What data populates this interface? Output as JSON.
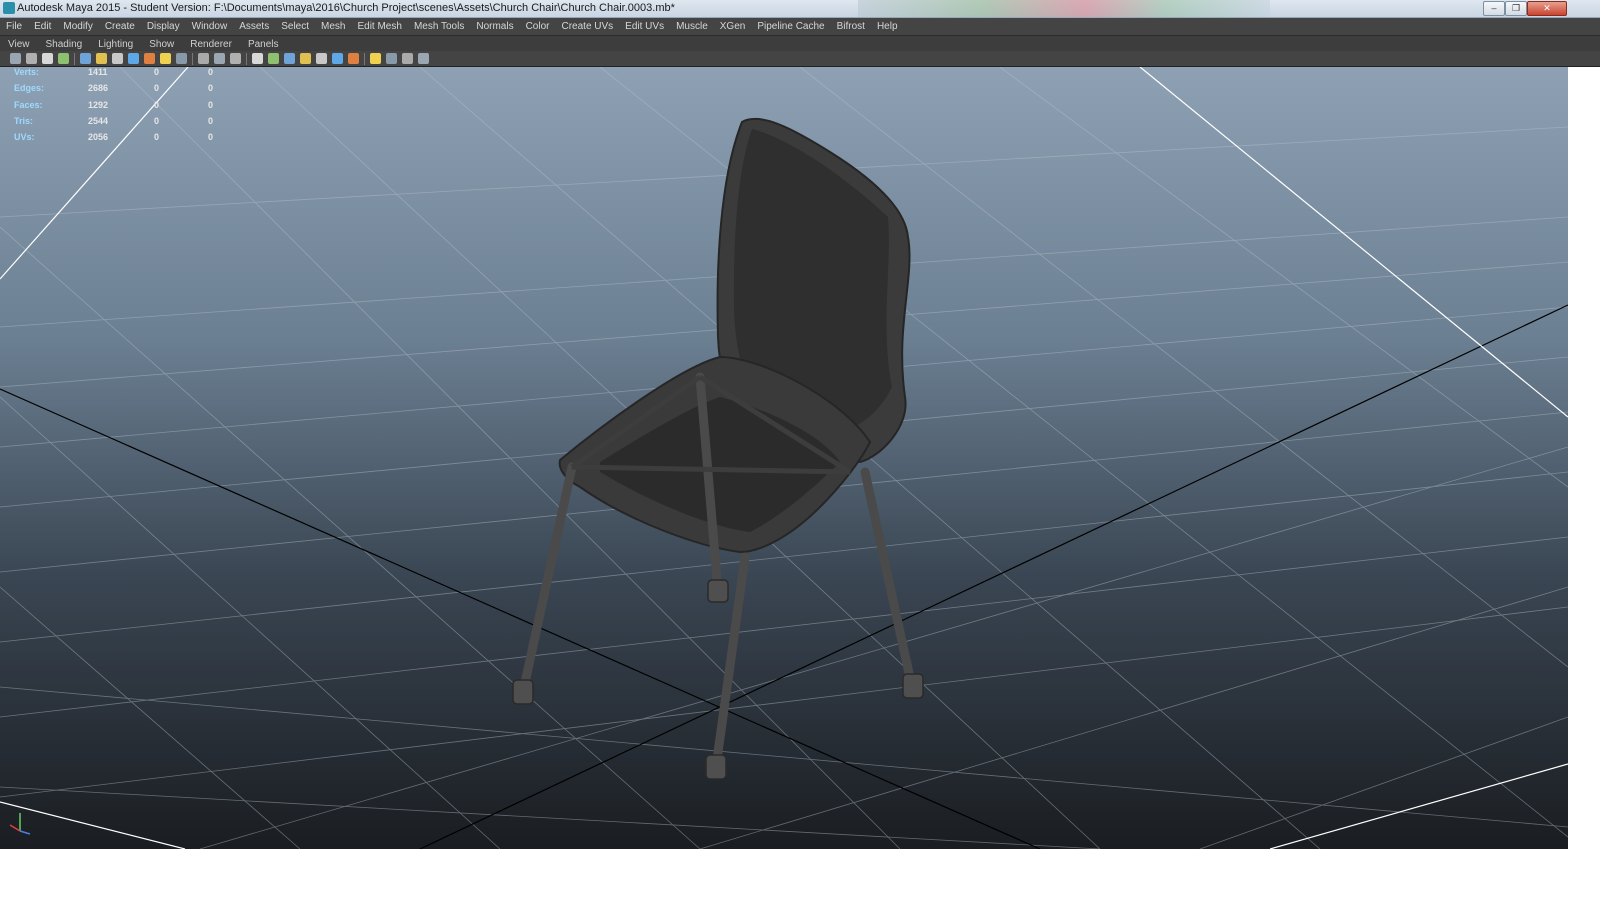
{
  "window": {
    "title": "Autodesk Maya 2015 - Student Version: F:\\Documents\\maya\\2016\\Church Project\\scenes\\Assets\\Church Chair\\Church Chair.0003.mb*",
    "minimize_icon": "minimize-icon",
    "restore_icon": "restore-icon",
    "close_icon": "close-icon"
  },
  "menubar": [
    "File",
    "Edit",
    "Modify",
    "Create",
    "Display",
    "Window",
    "Assets",
    "Select",
    "Mesh",
    "Edit Mesh",
    "Mesh Tools",
    "Normals",
    "Color",
    "Create UVs",
    "Edit UVs",
    "Muscle",
    "XGen",
    "Pipeline Cache",
    "Bifrost",
    "Help"
  ],
  "panel_menu": [
    "View",
    "Shading",
    "Lighting",
    "Show",
    "Renderer",
    "Panels"
  ],
  "toolbar_icons": [
    "camera-icon",
    "camera-attributes-icon",
    "bookmark-icon",
    "image-plane-icon",
    "grid-icon",
    "film-gate-icon",
    "resolution-gate-icon",
    "gate-mask-icon",
    "field-chart-icon",
    "safe-action-icon",
    "safe-title-icon",
    "wireframe-icon",
    "smooth-shade-icon",
    "textured-icon",
    "default-lighting-icon",
    "all-lights-icon",
    "shadows-icon",
    "ambient-occlusion-icon",
    "motion-blur-icon",
    "anti-aliasing-icon",
    "depth-of-field-icon",
    "isolate-select-icon",
    "xray-icon",
    "xray-joints-icon",
    "xray-active-icon"
  ],
  "hud": {
    "rows": [
      {
        "label": "Verts:",
        "v1": "1411",
        "v2": "0",
        "v3": "0"
      },
      {
        "label": "Edges:",
        "v1": "2686",
        "v2": "0",
        "v3": "0"
      },
      {
        "label": "Faces:",
        "v1": "1292",
        "v2": "0",
        "v3": "0"
      },
      {
        "label": "Tris:",
        "v1": "2544",
        "v2": "0",
        "v3": "0"
      },
      {
        "label": "UVs:",
        "v1": "2056",
        "v2": "0",
        "v3": "0"
      }
    ]
  },
  "colors": {
    "menubar_bg": "#444444",
    "viewport_top": "#8ea1b4",
    "viewport_bottom": "#1a1d21",
    "hud_label": "#9fd9ff",
    "hud_value": "#e6e6e6",
    "grid_line": "#b8c0c8"
  }
}
